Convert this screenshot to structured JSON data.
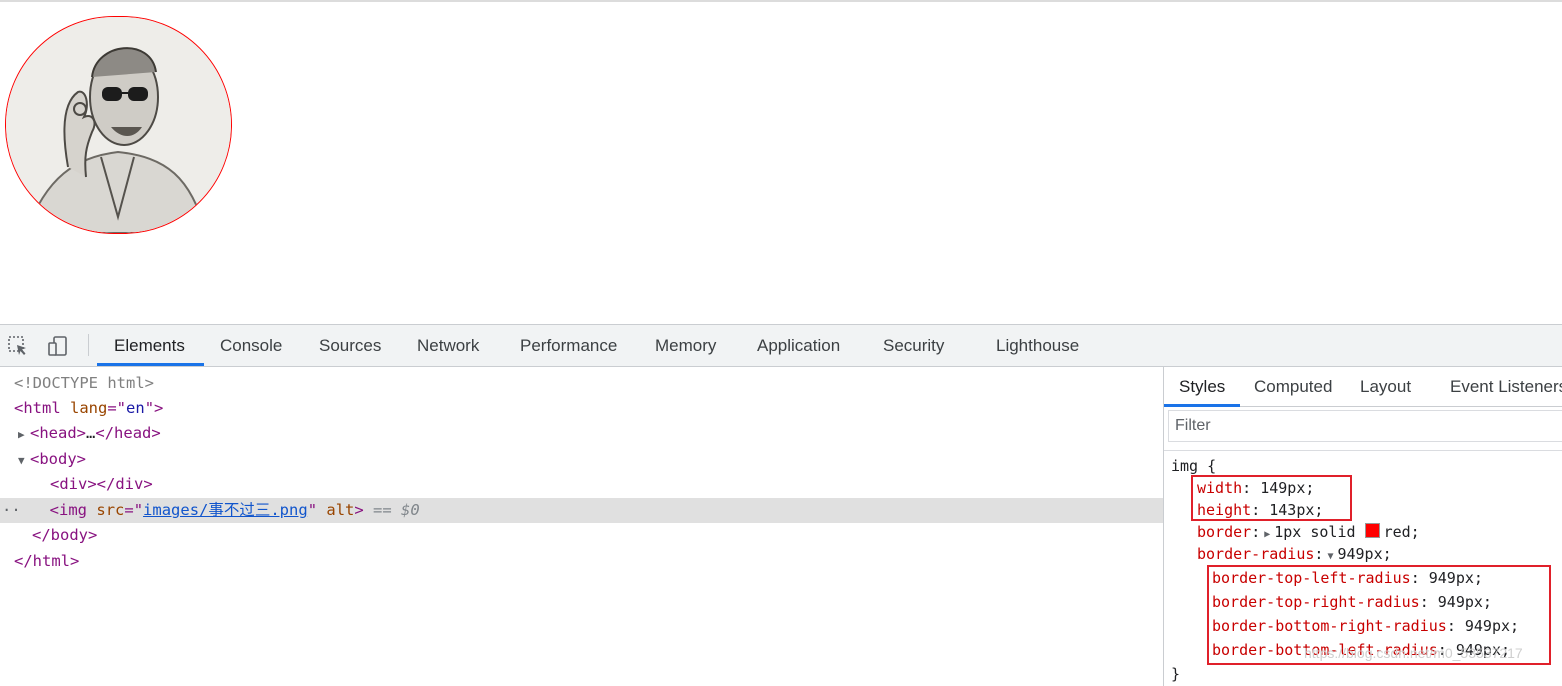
{
  "devtools": {
    "tabs": [
      "Elements",
      "Console",
      "Sources",
      "Network",
      "Performance",
      "Memory",
      "Application",
      "Security",
      "Lighthouse"
    ],
    "active_tab": "Elements",
    "icons": [
      "inspect-element-icon",
      "device-toolbar-icon"
    ]
  },
  "elements": {
    "doctype": "<!DOCTYPE html>",
    "html_open_tag": "html",
    "html_lang_attr": "lang",
    "html_lang_val": "en",
    "head_line": "head",
    "head_ellipsis": "…",
    "body_tag": "body",
    "div_tag": "div",
    "img_tag": "img",
    "img_src_attr": "src",
    "img_src_val": "images/事不过三.png",
    "img_alt_attr": "alt",
    "selected_marker": "== $0",
    "gutter": "··"
  },
  "styles": {
    "tabs": [
      "Styles",
      "Computed",
      "Layout",
      "Event Listeners"
    ],
    "active_tab": "Styles",
    "filter_placeholder": "Filter",
    "selector": "img {",
    "close_brace": "}",
    "props": [
      {
        "name": "width",
        "value": "149px;"
      },
      {
        "name": "height",
        "value": "143px;"
      },
      {
        "name": "border",
        "value": "1px solid",
        "color_name": "red;"
      },
      {
        "name": "border-radius",
        "value": "949px;"
      },
      {
        "name": "border-top-left-radius",
        "value": "949px;"
      },
      {
        "name": "border-top-right-radius",
        "value": "949px;"
      },
      {
        "name": "border-bottom-right-radius",
        "value": "949px;"
      },
      {
        "name": "border-bottom-left-radius",
        "value": "949px;"
      }
    ],
    "border_color": "#ff0000",
    "highlight_color": "#e0202a"
  },
  "colors": {
    "accent": "#1a73e8",
    "tag": "#881280",
    "attr_name": "#994500",
    "attr_value": "#1a1aa6",
    "prop_name": "#c80000"
  },
  "watermark": "https://blog.csdn.net/m0_53537217"
}
